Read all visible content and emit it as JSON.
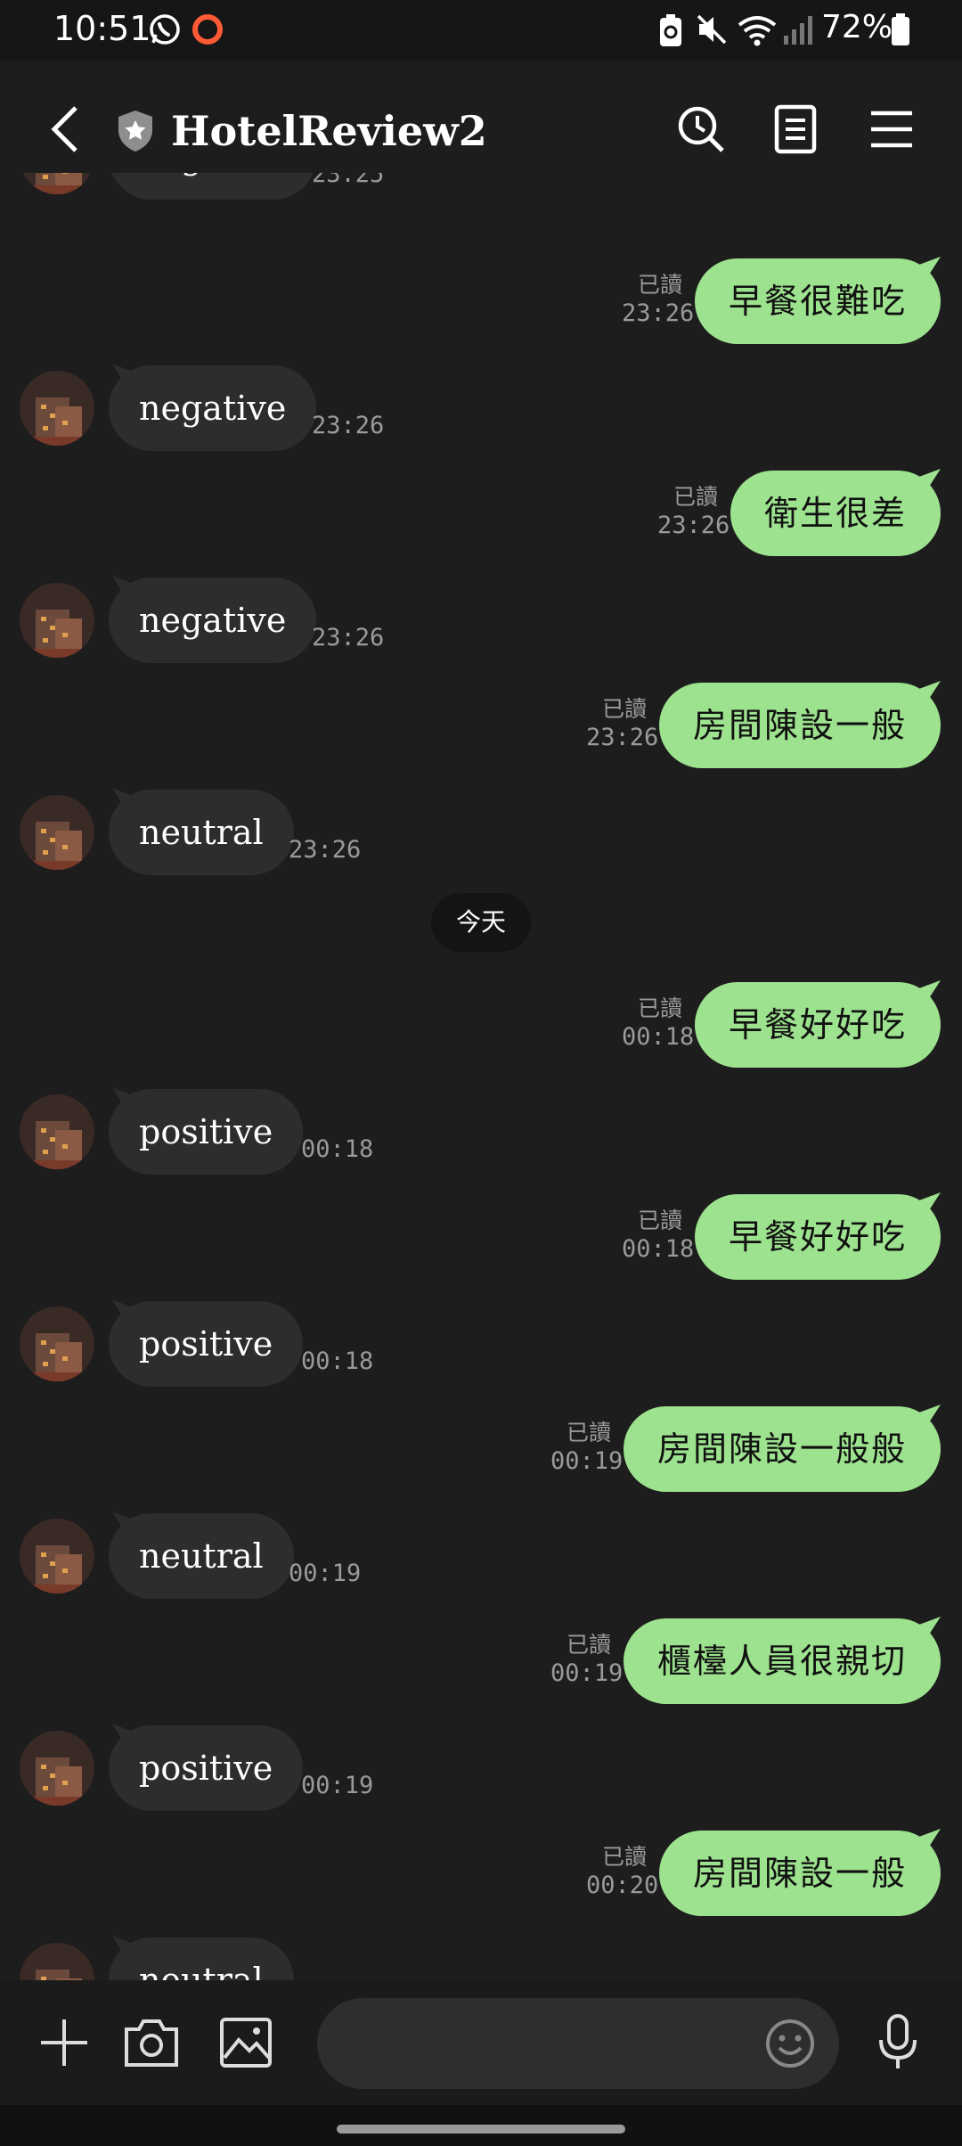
{
  "status_bar": {
    "time": "10:51",
    "battery": "72%",
    "icons": [
      "whatsapp-icon",
      "record-icon",
      "battery-saver-icon",
      "mute-icon",
      "wifi-icon",
      "signal-icon",
      "battery-icon"
    ]
  },
  "header": {
    "title": "HotelReview2",
    "icons": [
      "back-icon",
      "shield-star-icon",
      "search-clock-icon",
      "notes-icon",
      "menu-icon"
    ]
  },
  "chat": {
    "read_label": "已讀",
    "date_divider": "今天",
    "messages": [
      {
        "dir": "in",
        "text": "negative",
        "time": "23:25"
      },
      {
        "dir": "out",
        "text": "早餐很難吃",
        "time": "23:26"
      },
      {
        "dir": "in",
        "text": "negative",
        "time": "23:26"
      },
      {
        "dir": "out",
        "text": "衛生很差",
        "time": "23:26"
      },
      {
        "dir": "in",
        "text": "negative",
        "time": "23:26"
      },
      {
        "dir": "out",
        "text": "房間陳設一般",
        "time": "23:26"
      },
      {
        "dir": "in",
        "text": "neutral",
        "time": "23:26"
      },
      {
        "dir": "out",
        "text": "早餐好好吃",
        "time": "00:18"
      },
      {
        "dir": "in",
        "text": "positive",
        "time": "00:18"
      },
      {
        "dir": "out",
        "text": "早餐好好吃",
        "time": "00:18"
      },
      {
        "dir": "in",
        "text": "positive",
        "time": "00:18"
      },
      {
        "dir": "out",
        "text": "房間陳設一般般",
        "time": "00:19"
      },
      {
        "dir": "in",
        "text": "neutral",
        "time": "00:19"
      },
      {
        "dir": "out",
        "text": "櫃檯人員很親切",
        "time": "00:19"
      },
      {
        "dir": "in",
        "text": "positive",
        "time": "00:19"
      },
      {
        "dir": "out",
        "text": "房間陳設一般",
        "time": "00:20"
      },
      {
        "dir": "in",
        "text": "neutral",
        "time": ""
      }
    ]
  },
  "input_bar": {
    "placeholder": "",
    "icons": [
      "plus-icon",
      "camera-icon",
      "image-icon",
      "emoji-icon",
      "microphone-icon"
    ]
  },
  "colors": {
    "background": "#1d1d1d",
    "incoming_bubble": "#2d2d2d",
    "outgoing_bubble": "#9de28e"
  }
}
